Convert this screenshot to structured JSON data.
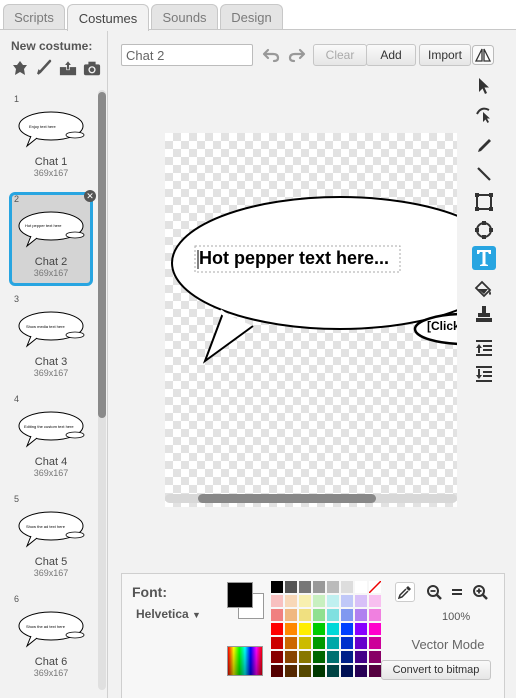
{
  "tabs": [
    {
      "label": "Scripts"
    },
    {
      "label": "Costumes"
    },
    {
      "label": "Sounds"
    },
    {
      "label": "Design"
    }
  ],
  "sidebar": {
    "new_costume_label": "New costume:",
    "costumes": [
      {
        "num": "1",
        "name": "Chat 1",
        "size": "369x167",
        "thumb_text": "Enjoy text here"
      },
      {
        "num": "2",
        "name": "Chat 2",
        "size": "369x167",
        "thumb_text": "Hot pepper text here"
      },
      {
        "num": "3",
        "name": "Chat 3",
        "size": "369x167",
        "thumb_text": "Show media text here"
      },
      {
        "num": "4",
        "name": "Chat 4",
        "size": "369x167",
        "thumb_text": "Editing the custom text here"
      },
      {
        "num": "5",
        "name": "Chat 5",
        "size": "369x167",
        "thumb_text": "Show the ad text here"
      },
      {
        "num": "6",
        "name": "Chat 6",
        "size": "369x167",
        "thumb_text": "Show the ad text here"
      }
    ],
    "scroll_fraction": 0.54
  },
  "toolbar": {
    "name_value": "Chat 2",
    "clear_label": "Clear",
    "add_label": "Add",
    "import_label": "Import"
  },
  "canvas": {
    "text": "Hot pepper text here...",
    "click_text": "[Click"
  },
  "bottom": {
    "font_label": "Font:",
    "font_value": "Helvetica",
    "zoom": "100%",
    "mode": "Vector Mode",
    "convert_label": "Convert to bitmap"
  },
  "palette": [
    "#000000",
    "#555555",
    "#777777",
    "#999999",
    "#bbbbbb",
    "#dddddd",
    "#ffffff",
    "none",
    "#f8c0c0",
    "#f8d8b8",
    "#f8f0b0",
    "#c8f0c0",
    "#c0f0f0",
    "#c0c8f8",
    "#d8c0f8",
    "#f8c0f0",
    "#f08080",
    "#f0b880",
    "#f0e080",
    "#90e090",
    "#80e0e0",
    "#8098f0",
    "#b080f0",
    "#f080e0",
    "#ff0000",
    "#ff8800",
    "#ffee00",
    "#00cc00",
    "#00d8d8",
    "#0040ff",
    "#8800ff",
    "#ff00cc",
    "#cc0000",
    "#cc6600",
    "#ccbb00",
    "#009900",
    "#00a8a8",
    "#0030cc",
    "#6600cc",
    "#cc0099",
    "#880000",
    "#884400",
    "#887700",
    "#006600",
    "#007070",
    "#002088",
    "#440088",
    "#880066",
    "#550000",
    "#552800",
    "#554800",
    "#003800",
    "#004444",
    "#001055",
    "#280055",
    "#550040"
  ],
  "colors": {
    "accent": "#28a5e1",
    "primary_swatch": "#000000",
    "secondary_swatch": "#ffffff"
  }
}
